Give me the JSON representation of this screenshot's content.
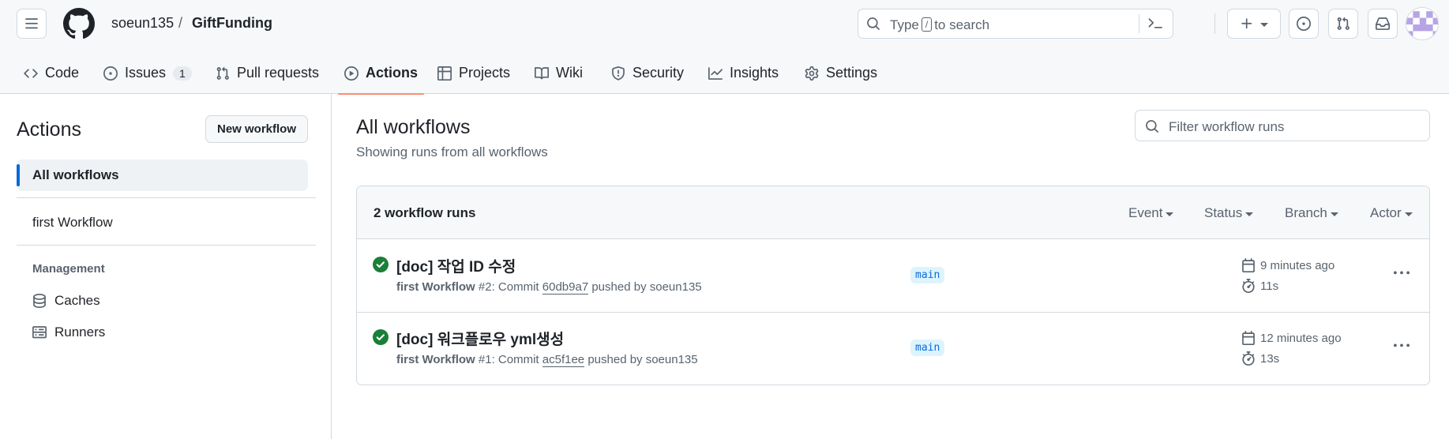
{
  "header": {
    "owner": "soeun135",
    "separator": "/",
    "repo": "GiftFunding",
    "search_prefix": "Type",
    "search_key": "/",
    "search_suffix": "to search"
  },
  "nav": {
    "code": "Code",
    "issues": "Issues",
    "issues_count": "1",
    "pulls": "Pull requests",
    "actions": "Actions",
    "projects": "Projects",
    "wiki": "Wiki",
    "security": "Security",
    "insights": "Insights",
    "settings": "Settings"
  },
  "sidebar": {
    "title": "Actions",
    "new_workflow": "New workflow",
    "all_workflows": "All workflows",
    "workflow_1": "first Workflow",
    "management_heading": "Management",
    "caches": "Caches",
    "runners": "Runners"
  },
  "main": {
    "title": "All workflows",
    "subtitle": "Showing runs from all workflows",
    "filter_placeholder": "Filter workflow runs",
    "runs_count": "2 workflow runs",
    "filters": {
      "event": "Event",
      "status": "Status",
      "branch": "Branch",
      "actor": "Actor"
    },
    "runs": [
      {
        "title": "[doc] 작업 ID 수정",
        "workflow": "first Workflow",
        "number": "#2",
        "commit_prefix": ": Commit",
        "commit": "60db9a7",
        "pushed_by": "pushed by soeun135",
        "branch": "main",
        "when": "9 minutes ago",
        "duration": "11s"
      },
      {
        "title": "[doc] 워크플로우 yml생성",
        "workflow": "first Workflow",
        "number": "#1",
        "commit_prefix": ": Commit",
        "commit": "ac5f1ee",
        "pushed_by": "pushed by soeun135",
        "branch": "main",
        "when": "12 minutes ago",
        "duration": "13s"
      }
    ]
  },
  "colors": {
    "success": "#1a7f37",
    "accent": "#0969da",
    "active_tab": "#fd8c73"
  }
}
